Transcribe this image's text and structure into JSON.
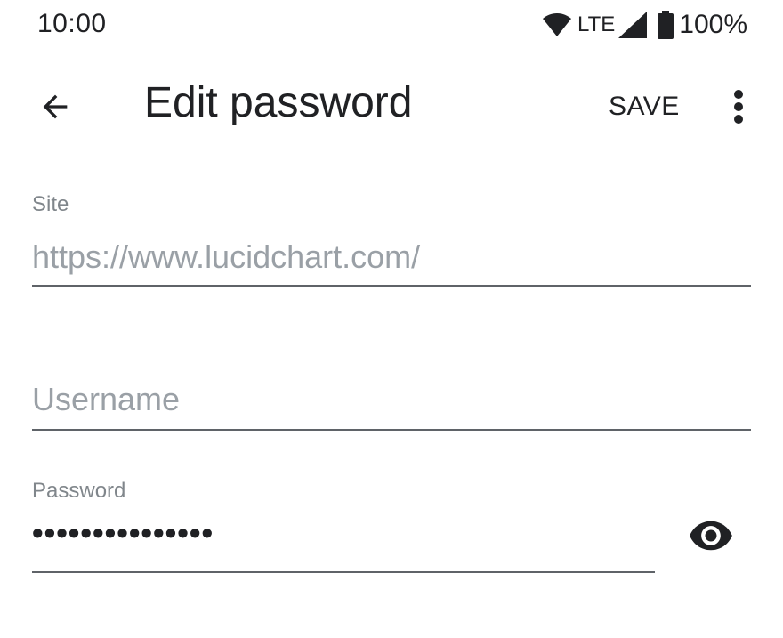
{
  "status_bar": {
    "time": "10:00",
    "network": "LTE",
    "battery": "100%",
    "icons": [
      "wifi-icon",
      "signal-icon",
      "battery-icon"
    ]
  },
  "app_bar": {
    "title": "Edit password",
    "save_label": "SAVE",
    "icons": [
      "back-arrow-icon",
      "more-vert-icon"
    ]
  },
  "form": {
    "site": {
      "label": "Site",
      "value": "https://www.lucidchart.com/"
    },
    "username": {
      "placeholder": "Username",
      "value": ""
    },
    "password": {
      "label": "Password",
      "masked_value": "•••••••••••••••",
      "toggle_icon": "eye-icon"
    }
  },
  "colors": {
    "text_primary": "#202124",
    "text_secondary": "#80868b",
    "text_hint": "#9aa0a6",
    "underline": "#5f6368",
    "background": "#ffffff"
  }
}
